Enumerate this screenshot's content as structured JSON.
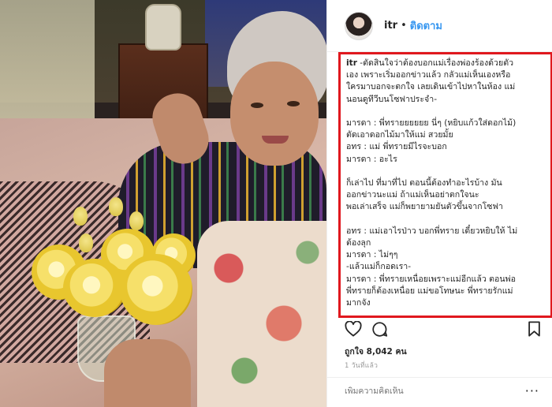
{
  "post": {
    "username": "itr",
    "separator": "•",
    "follow_label": "ติดตาม",
    "caption_lines": [
      {
        "user": "itr",
        "text": " -ตัดสินใจว่าต้องบอกแม่เรื่องพ่องร้องด้วยตัว"
      },
      {
        "text": "เอง เพราะเริ่มออกข่าวแล้ว กลัวแม่เห็นเองหรือ"
      },
      {
        "text": "ใครมาบอกจะตกใจ เลยเดินเข้าไปหาในห้อง แม่"
      },
      {
        "text": "นอนดูทีวีบนโซฟาประจำ-"
      },
      {
        "text": ""
      },
      {
        "text": "มารดา : พี่ทรายยยยยย นี่ๆ (หยิบแก้วใส่ดอกไม้)"
      },
      {
        "text": "ตัดเอาดอกไม้มาให้แม่ สวยมั้ย"
      },
      {
        "text": "อทร : แม่ พี่ทรายมีไรจะบอก"
      },
      {
        "text": "มารดา : อะไร"
      },
      {
        "text": ""
      },
      {
        "text": "ก็เล่าไป ที่มาที่ไป ตอนนี้ต้องทำอะไรบ้าง มัน"
      },
      {
        "text": "ออกข่าวนะแม่ ถ้าแม่เห็นอย่าตกใจนะ"
      },
      {
        "text": "พอเล่าเสร็จ แม่ก็พยายามยันตัวขึ้นจากโซฟา"
      },
      {
        "text": ""
      },
      {
        "text": "อทร : แม่เอาไรป่าว บอกพี่ทราย เดี๋ยวหยิบให้ ไม่"
      },
      {
        "text": "ต้องลุก"
      },
      {
        "text": "มารดา : ไม่ๆๆ"
      },
      {
        "text": "-แล้วแม่ก็กอดเรา-"
      },
      {
        "text": "มารดา : พี่ทรายเหนื่อยเพราะแม่อีกแล้ว ตอนพ่อ"
      },
      {
        "text": "พี่ทรายก็ต้องเหนื่อย แม่ขอโทษนะ พี่ทรายรักแม่"
      },
      {
        "text": "มากจัง"
      }
    ],
    "likes_text": "ถูกใจ 8,042 คน",
    "time_text": "1 วันที่แล้ว",
    "comment_placeholder": "เพิ่มความคิดเห็น",
    "more_label": "···"
  },
  "icons": {
    "like": "heart-icon",
    "comment": "comment-icon",
    "save": "bookmark-icon"
  },
  "colors": {
    "highlight_border": "#e0181e",
    "follow_link": "#3897f0",
    "text": "#262626",
    "muted": "#999999"
  }
}
